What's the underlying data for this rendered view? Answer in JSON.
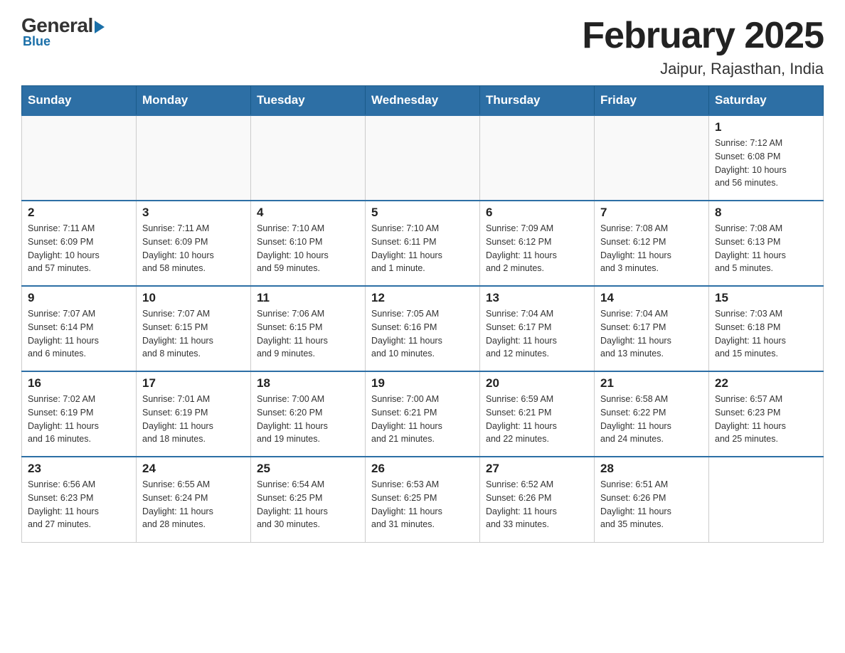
{
  "logo": {
    "general": "General",
    "blue": "Blue",
    "blue_sub": "Blue"
  },
  "header": {
    "title": "February 2025",
    "subtitle": "Jaipur, Rajasthan, India"
  },
  "days_of_week": [
    "Sunday",
    "Monday",
    "Tuesday",
    "Wednesday",
    "Thursday",
    "Friday",
    "Saturday"
  ],
  "weeks": [
    [
      {
        "day": "",
        "info": ""
      },
      {
        "day": "",
        "info": ""
      },
      {
        "day": "",
        "info": ""
      },
      {
        "day": "",
        "info": ""
      },
      {
        "day": "",
        "info": ""
      },
      {
        "day": "",
        "info": ""
      },
      {
        "day": "1",
        "info": "Sunrise: 7:12 AM\nSunset: 6:08 PM\nDaylight: 10 hours\nand 56 minutes."
      }
    ],
    [
      {
        "day": "2",
        "info": "Sunrise: 7:11 AM\nSunset: 6:09 PM\nDaylight: 10 hours\nand 57 minutes."
      },
      {
        "day": "3",
        "info": "Sunrise: 7:11 AM\nSunset: 6:09 PM\nDaylight: 10 hours\nand 58 minutes."
      },
      {
        "day": "4",
        "info": "Sunrise: 7:10 AM\nSunset: 6:10 PM\nDaylight: 10 hours\nand 59 minutes."
      },
      {
        "day": "5",
        "info": "Sunrise: 7:10 AM\nSunset: 6:11 PM\nDaylight: 11 hours\nand 1 minute."
      },
      {
        "day": "6",
        "info": "Sunrise: 7:09 AM\nSunset: 6:12 PM\nDaylight: 11 hours\nand 2 minutes."
      },
      {
        "day": "7",
        "info": "Sunrise: 7:08 AM\nSunset: 6:12 PM\nDaylight: 11 hours\nand 3 minutes."
      },
      {
        "day": "8",
        "info": "Sunrise: 7:08 AM\nSunset: 6:13 PM\nDaylight: 11 hours\nand 5 minutes."
      }
    ],
    [
      {
        "day": "9",
        "info": "Sunrise: 7:07 AM\nSunset: 6:14 PM\nDaylight: 11 hours\nand 6 minutes."
      },
      {
        "day": "10",
        "info": "Sunrise: 7:07 AM\nSunset: 6:15 PM\nDaylight: 11 hours\nand 8 minutes."
      },
      {
        "day": "11",
        "info": "Sunrise: 7:06 AM\nSunset: 6:15 PM\nDaylight: 11 hours\nand 9 minutes."
      },
      {
        "day": "12",
        "info": "Sunrise: 7:05 AM\nSunset: 6:16 PM\nDaylight: 11 hours\nand 10 minutes."
      },
      {
        "day": "13",
        "info": "Sunrise: 7:04 AM\nSunset: 6:17 PM\nDaylight: 11 hours\nand 12 minutes."
      },
      {
        "day": "14",
        "info": "Sunrise: 7:04 AM\nSunset: 6:17 PM\nDaylight: 11 hours\nand 13 minutes."
      },
      {
        "day": "15",
        "info": "Sunrise: 7:03 AM\nSunset: 6:18 PM\nDaylight: 11 hours\nand 15 minutes."
      }
    ],
    [
      {
        "day": "16",
        "info": "Sunrise: 7:02 AM\nSunset: 6:19 PM\nDaylight: 11 hours\nand 16 minutes."
      },
      {
        "day": "17",
        "info": "Sunrise: 7:01 AM\nSunset: 6:19 PM\nDaylight: 11 hours\nand 18 minutes."
      },
      {
        "day": "18",
        "info": "Sunrise: 7:00 AM\nSunset: 6:20 PM\nDaylight: 11 hours\nand 19 minutes."
      },
      {
        "day": "19",
        "info": "Sunrise: 7:00 AM\nSunset: 6:21 PM\nDaylight: 11 hours\nand 21 minutes."
      },
      {
        "day": "20",
        "info": "Sunrise: 6:59 AM\nSunset: 6:21 PM\nDaylight: 11 hours\nand 22 minutes."
      },
      {
        "day": "21",
        "info": "Sunrise: 6:58 AM\nSunset: 6:22 PM\nDaylight: 11 hours\nand 24 minutes."
      },
      {
        "day": "22",
        "info": "Sunrise: 6:57 AM\nSunset: 6:23 PM\nDaylight: 11 hours\nand 25 minutes."
      }
    ],
    [
      {
        "day": "23",
        "info": "Sunrise: 6:56 AM\nSunset: 6:23 PM\nDaylight: 11 hours\nand 27 minutes."
      },
      {
        "day": "24",
        "info": "Sunrise: 6:55 AM\nSunset: 6:24 PM\nDaylight: 11 hours\nand 28 minutes."
      },
      {
        "day": "25",
        "info": "Sunrise: 6:54 AM\nSunset: 6:25 PM\nDaylight: 11 hours\nand 30 minutes."
      },
      {
        "day": "26",
        "info": "Sunrise: 6:53 AM\nSunset: 6:25 PM\nDaylight: 11 hours\nand 31 minutes."
      },
      {
        "day": "27",
        "info": "Sunrise: 6:52 AM\nSunset: 6:26 PM\nDaylight: 11 hours\nand 33 minutes."
      },
      {
        "day": "28",
        "info": "Sunrise: 6:51 AM\nSunset: 6:26 PM\nDaylight: 11 hours\nand 35 minutes."
      },
      {
        "day": "",
        "info": ""
      }
    ]
  ]
}
